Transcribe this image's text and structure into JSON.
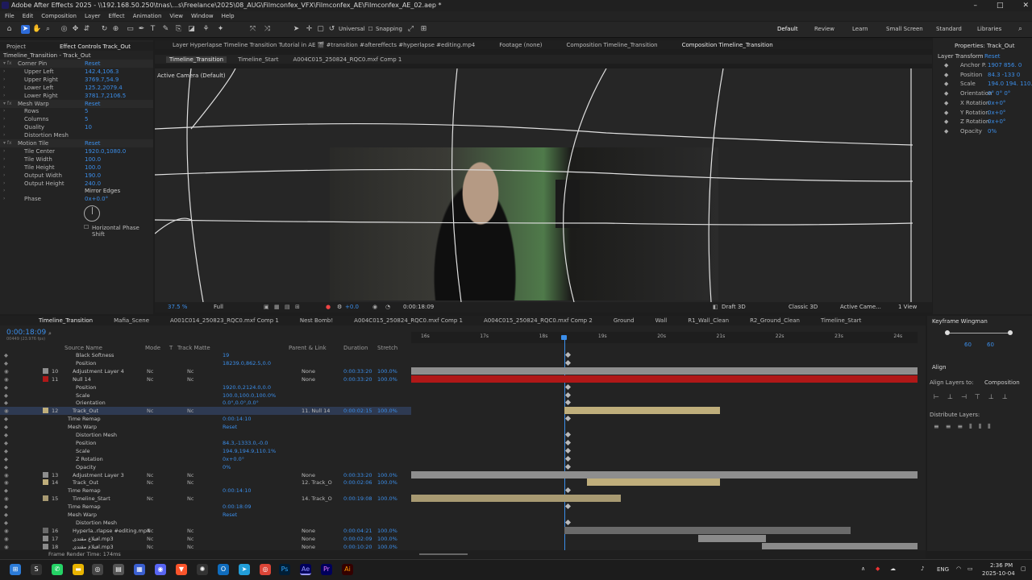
{
  "window": {
    "title": "Adobe After Effects 2025 - \\\\192.168.50.250\\tnas\\...s\\Freelance\\2025\\08_AUG\\Filmconfex_VFX\\Filmconfex_AE\\Filmconfex_AE_02.aep *"
  },
  "menu": [
    "File",
    "Edit",
    "Composition",
    "Layer",
    "Effect",
    "Animation",
    "View",
    "Window",
    "Help"
  ],
  "toolbar": {
    "universal": "Universal",
    "snapping": "Snapping"
  },
  "workspaces": [
    "Default",
    "Review",
    "Learn",
    "Small Screen",
    "Standard",
    "Libraries"
  ],
  "left_panel": {
    "tabs": [
      "Project",
      "Effect Controls Track_Out"
    ],
    "header": "Timeline_Transition - Track_Out",
    "rows": [
      {
        "label": "Corner Pin",
        "value": "Reset",
        "kind": "fx"
      },
      {
        "label": "Upper Left",
        "value": "142.4,106.3"
      },
      {
        "label": "Upper Right",
        "value": "3769.7,54.9"
      },
      {
        "label": "Lower Left",
        "value": "125.2,2079.4"
      },
      {
        "label": "Lower Right",
        "value": "3781.7,2106.5"
      },
      {
        "label": "Mesh Warp",
        "value": "Reset",
        "kind": "fx"
      },
      {
        "label": "Rows",
        "value": "5"
      },
      {
        "label": "Columns",
        "value": "5"
      },
      {
        "label": "Quality",
        "value": "10"
      },
      {
        "label": "Distortion Mesh",
        "value": ""
      },
      {
        "label": "Motion Tile",
        "value": "Reset",
        "kind": "fx"
      },
      {
        "label": "Tile Center",
        "value": "1920.0,1080.0"
      },
      {
        "label": "Tile Width",
        "value": "100.0"
      },
      {
        "label": "Tile Height",
        "value": "100.0"
      },
      {
        "label": "Output Width",
        "value": "190.0"
      },
      {
        "label": "Output Height",
        "value": "240.0"
      },
      {
        "label": "",
        "value": "Mirror Edges"
      },
      {
        "label": "Phase",
        "value": "0x+0.0°"
      }
    ],
    "horizontal_phase_shift": "Horizontal Phase Shift"
  },
  "comp_tabs": {
    "row1": [
      "Layer Hyperlapse Timeline Transition Tutorial in AE 🎬 #transition #aftereffects #hyperlapse #editing.mp4",
      "Footage (none)",
      "Composition Timeline_Transition",
      "Composition Timeline_Transition"
    ],
    "row2": [
      "Timeline_Transition",
      "Timeline_Start",
      "A004C015_250824_RQC0.mxf Comp 1"
    ]
  },
  "viewer": {
    "camera": "Active Camera (Default)",
    "zoom": "37.5 %",
    "resolution": "Full",
    "exposure": "+0.0",
    "timecode": "0:00:18:09",
    "renderer": "Draft 3D",
    "renderer2": "Classic 3D",
    "camera_select": "Active Came...",
    "views": "1 View"
  },
  "properties_panel": {
    "title": "Properties: Track_Out",
    "section": "Layer Transform",
    "reset": "Reset",
    "rows": [
      {
        "label": "Anchor P.",
        "values": "1907   856.   0"
      },
      {
        "label": "Position",
        "values": "84.3   -133   0"
      },
      {
        "label": "Scale",
        "values": "194.0   194.   110."
      },
      {
        "label": "Orientation",
        "values": "0°   0°   0°"
      },
      {
        "label": "X Rotation",
        "values": "0x+0°"
      },
      {
        "label": "Y Rotation",
        "values": "0x+0°"
      },
      {
        "label": "Z Rotation",
        "values": "0x+0°"
      },
      {
        "label": "Opacity",
        "values": "0%"
      }
    ]
  },
  "timeline": {
    "tabs": [
      "Timeline_Transition",
      "Mafia_Scene",
      "A001C014_250823_RQC0.mxf Comp 1",
      "Nest Bomb!",
      "A004C015_250824_RQC0.mxf Comp 1",
      "A004C015_250824_RQC0.mxf Comp 2",
      "Ground",
      "Wall",
      "R1_Wall_Clean",
      "R2_Ground_Clean",
      "Timeline_Start"
    ],
    "timecode": "0:00:18:09",
    "fps_note": "00449 (23.976 fps)",
    "columns": [
      "Source Name",
      "Mode",
      "T",
      "Track Matte",
      "Parent & Link",
      "Duration",
      "Stretch"
    ],
    "ruler": [
      "16s",
      "17s",
      "18s",
      "19s",
      "20s",
      "21s",
      "22s",
      "23s",
      "24s"
    ],
    "rows": [
      {
        "num": "",
        "name": "Black Softness",
        "mode": "",
        "matte": "",
        "parent": "19",
        "dur": "",
        "stretch": "",
        "indent": 2
      },
      {
        "num": "",
        "name": "Position",
        "mode": "",
        "matte": "",
        "parent": "18239.0,862.5,0.0",
        "dur": "",
        "stretch": "",
        "indent": 2
      },
      {
        "num": "10",
        "name": "Adjustment Layer 4",
        "mode": "Nc",
        "matte": "Nc",
        "parent": "None",
        "dur": "0:00:33:20",
        "stretch": "100.0%",
        "indent": 0
      },
      {
        "num": "11",
        "name": "Null 14",
        "mode": "Nc",
        "matte": "Nc",
        "parent": "None",
        "dur": "0:00:33:20",
        "stretch": "100.0%",
        "indent": 0
      },
      {
        "num": "",
        "name": "Position",
        "mode": "",
        "matte": "",
        "parent": "1920.0,2124.0,0.0",
        "dur": "",
        "stretch": "",
        "indent": 2
      },
      {
        "num": "",
        "name": "Scale",
        "mode": "",
        "matte": "",
        "parent": "100.0,100.0,100.0%",
        "dur": "",
        "stretch": "",
        "indent": 2
      },
      {
        "num": "",
        "name": "Orientation",
        "mode": "",
        "matte": "",
        "parent": "0.0°,0.0°,0.0°",
        "dur": "",
        "stretch": "",
        "indent": 2
      },
      {
        "num": "12",
        "name": "Track_Out",
        "mode": "Nc",
        "matte": "Nc",
        "parent": "11. Null 14",
        "dur": "0:00:02:15",
        "stretch": "100.0%",
        "indent": 0
      },
      {
        "num": "",
        "name": "Time Remap",
        "mode": "",
        "matte": "",
        "parent": "0:00:14:10",
        "dur": "",
        "stretch": "",
        "indent": 1
      },
      {
        "num": "",
        "name": "Mesh Warp",
        "mode": "",
        "matte": "",
        "parent": "Reset",
        "dur": "",
        "stretch": "",
        "indent": 1
      },
      {
        "num": "",
        "name": "Distortion Mesh",
        "mode": "",
        "matte": "",
        "parent": "",
        "dur": "",
        "stretch": "",
        "indent": 2
      },
      {
        "num": "",
        "name": "Position",
        "mode": "",
        "matte": "",
        "parent": "84.3,-1333.0,-0.0",
        "dur": "",
        "stretch": "",
        "indent": 2
      },
      {
        "num": "",
        "name": "Scale",
        "mode": "",
        "matte": "",
        "parent": "194.9,194.9,110.1%",
        "dur": "",
        "stretch": "",
        "indent": 2
      },
      {
        "num": "",
        "name": "Z Rotation",
        "mode": "",
        "matte": "",
        "parent": "0x+0.0°",
        "dur": "",
        "stretch": "",
        "indent": 2
      },
      {
        "num": "",
        "name": "Opacity",
        "mode": "",
        "matte": "",
        "parent": "0%",
        "dur": "",
        "stretch": "",
        "indent": 2
      },
      {
        "num": "13",
        "name": "Adjustment Layer 3",
        "mode": "Nc",
        "matte": "Nc",
        "parent": "None",
        "dur": "0:00:33:20",
        "stretch": "100.0%",
        "indent": 0
      },
      {
        "num": "14",
        "name": "Track_Out",
        "mode": "Nc",
        "matte": "Nc",
        "parent": "12. Track_O",
        "dur": "0:00:02:06",
        "stretch": "100.0%",
        "indent": 0
      },
      {
        "num": "",
        "name": "Time Remap",
        "mode": "",
        "matte": "",
        "parent": "0:00:14:10",
        "dur": "",
        "stretch": "",
        "indent": 1
      },
      {
        "num": "15",
        "name": "Timeline_Start",
        "mode": "Nc",
        "matte": "Nc",
        "parent": "14. Track_O",
        "dur": "0:00:19:08",
        "stretch": "100.0%",
        "indent": 0
      },
      {
        "num": "",
        "name": "Time Remap",
        "mode": "",
        "matte": "",
        "parent": "0:00:18:09",
        "dur": "",
        "stretch": "",
        "indent": 1
      },
      {
        "num": "",
        "name": "Mesh Warp",
        "mode": "",
        "matte": "",
        "parent": "Reset",
        "dur": "",
        "stretch": "",
        "indent": 1
      },
      {
        "num": "",
        "name": "Distortion Mesh",
        "mode": "",
        "matte": "",
        "parent": "",
        "dur": "",
        "stretch": "",
        "indent": 2
      },
      {
        "num": "16",
        "name": "Hyperla..rlapse #editing.mp4",
        "mode": "Nc",
        "matte": "Nc",
        "parent": "None",
        "dur": "0:00:04:21",
        "stretch": "100.0%",
        "indent": 0
      },
      {
        "num": "17",
        "name": "اقتلاع مقتدى.mp3",
        "mode": "Nc",
        "matte": "Nc",
        "parent": "None",
        "dur": "0:00:02:09",
        "stretch": "100.0%",
        "indent": 0
      },
      {
        "num": "18",
        "name": "اقتلاع مقتدى.mp3",
        "mode": "Nc",
        "matte": "Nc",
        "parent": "None",
        "dur": "0:00:10:20",
        "stretch": "100.0%",
        "indent": 0
      }
    ],
    "frame_render_time": "Frame Render Time: 174ms"
  },
  "keyframe_wingman": {
    "title": "Keyframe Wingman",
    "left": "60",
    "right": "60"
  },
  "align": {
    "title": "Align",
    "align_to_label": "Align Layers to:",
    "align_to_value": "Composition",
    "distribute": "Distribute Layers:"
  },
  "taskbar": {
    "lang": "ENG",
    "time": "2:36 PM",
    "date": "2025-10-04"
  }
}
